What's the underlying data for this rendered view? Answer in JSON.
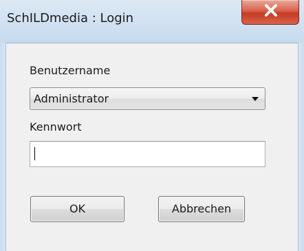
{
  "window": {
    "title": "SchILDmedia : Login"
  },
  "form": {
    "username_label": "Benutzername",
    "username_selected": "Administrator",
    "password_label": "Kennwort",
    "password_value": ""
  },
  "buttons": {
    "ok_label": "OK",
    "cancel_label": "Abbrechen"
  },
  "icons": {
    "close": "close-icon",
    "dropdown": "chevron-down-icon"
  },
  "colors": {
    "close_button": "#d04a35",
    "title_bar": "#cfe0f1",
    "client_background": "#f0f0f0"
  }
}
